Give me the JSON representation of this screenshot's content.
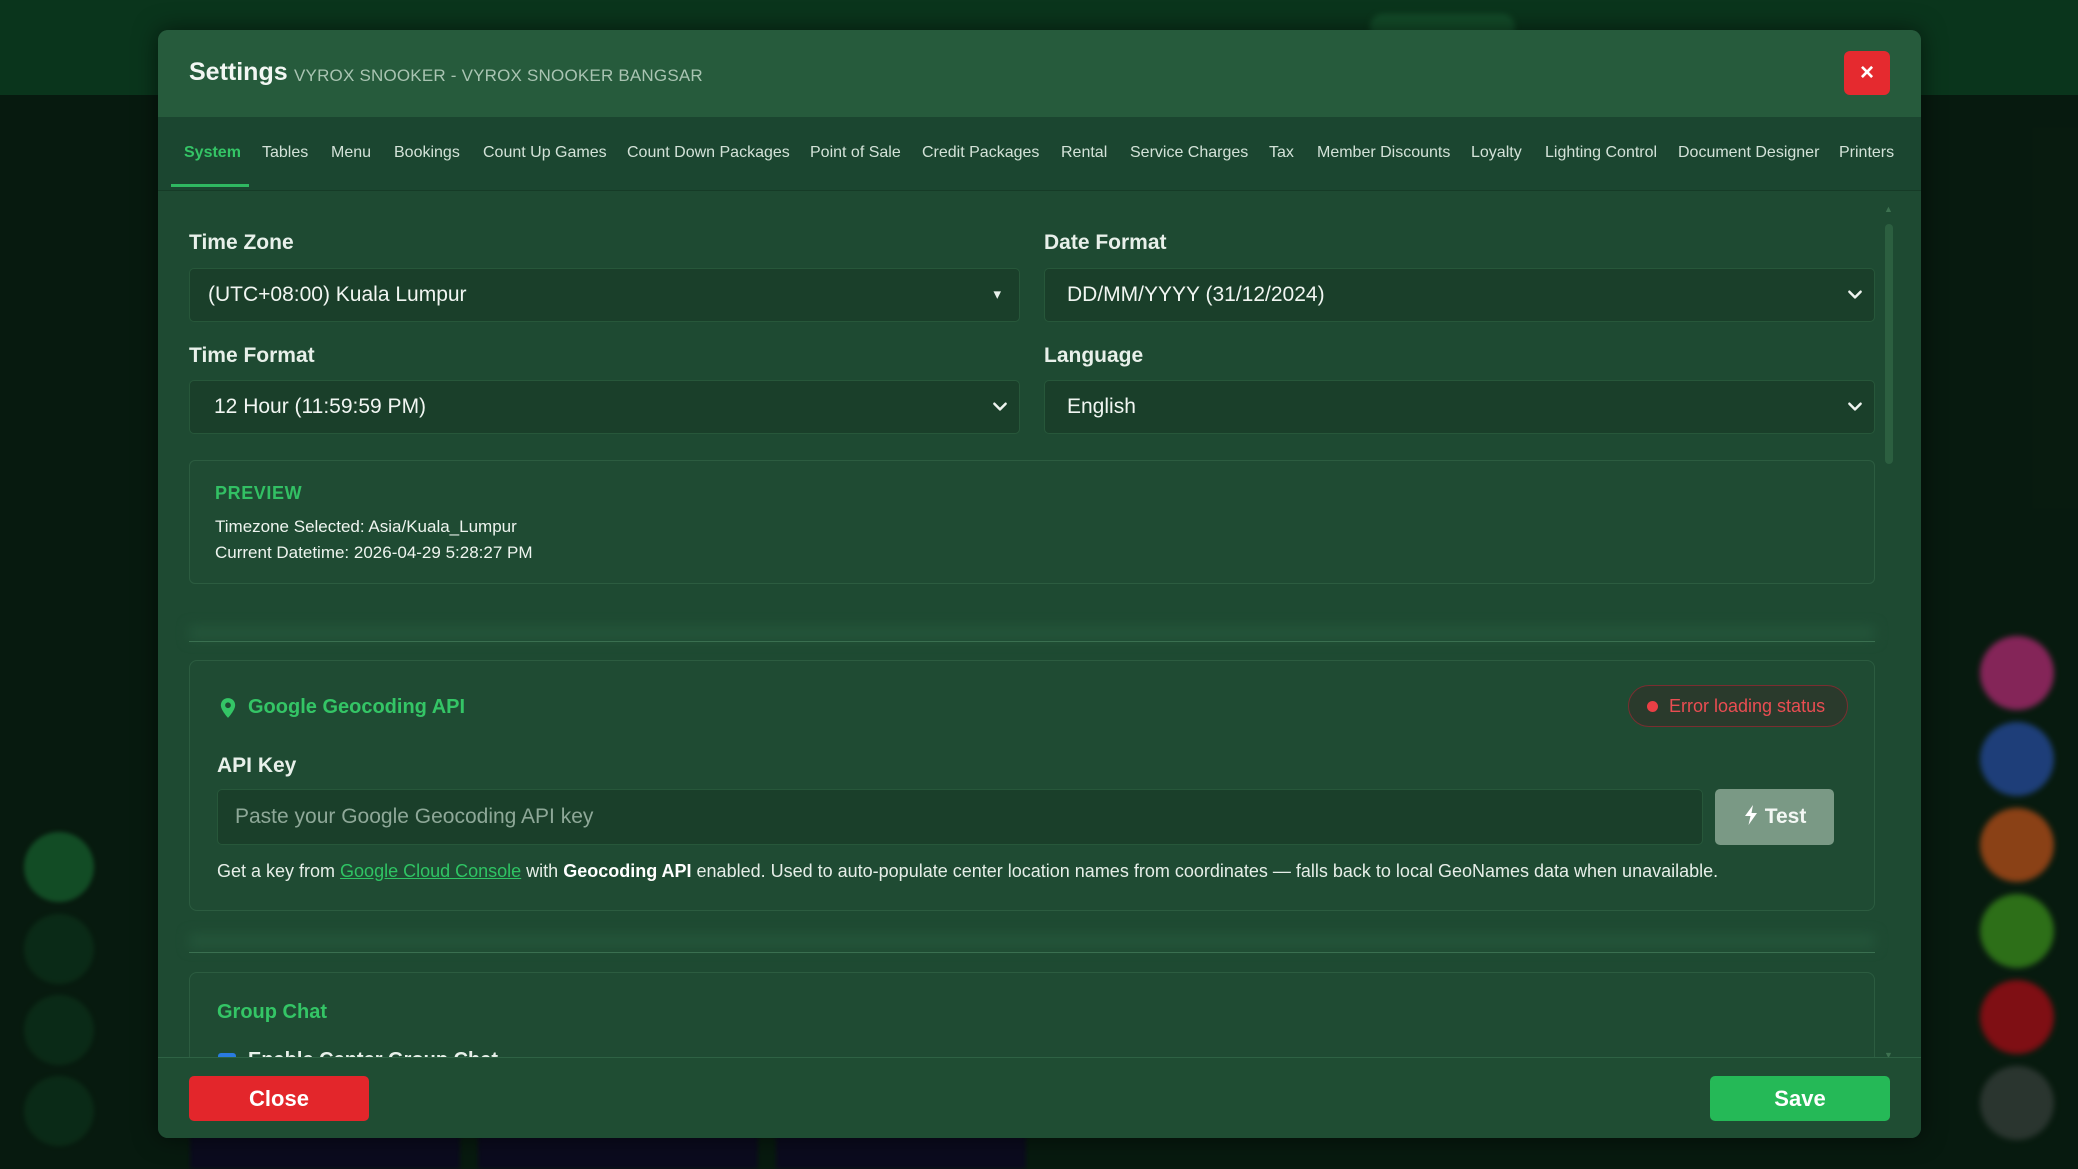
{
  "modal": {
    "title": "Settings",
    "subtitle": "VYROX SNOOKER - VYROX SNOOKER BANGSAR",
    "close_icon": "×"
  },
  "tabs": [
    {
      "label": "System",
      "active": true
    },
    {
      "label": "Tables"
    },
    {
      "label": "Menu"
    },
    {
      "label": "Bookings"
    },
    {
      "label": "Count Up Games"
    },
    {
      "label": "Count Down Packages"
    },
    {
      "label": "Point of Sale"
    },
    {
      "label": "Credit Packages"
    },
    {
      "label": "Rental"
    },
    {
      "label": "Service Charges"
    },
    {
      "label": "Tax"
    },
    {
      "label": "Member Discounts"
    },
    {
      "label": "Loyalty"
    },
    {
      "label": "Lighting Control"
    },
    {
      "label": "Document Designer"
    },
    {
      "label": "Printers"
    }
  ],
  "system": {
    "time_zone": {
      "label": "Time Zone",
      "value": "(UTC+08:00) Kuala Lumpur"
    },
    "date_format": {
      "label": "Date Format",
      "value": "DD/MM/YYYY (31/12/2024)"
    },
    "time_format": {
      "label": "Time Format",
      "value": "12 Hour (11:59:59 PM)"
    },
    "language": {
      "label": "Language",
      "value": "English"
    },
    "preview": {
      "title": "PREVIEW",
      "timezone_line": "Timezone Selected: Asia/Kuala_Lumpur",
      "datetime_line": "Current Datetime: 2026-04-29 5:28:27 PM"
    }
  },
  "geocoding": {
    "title": "Google Geocoding API",
    "status": "Error loading status",
    "api_key_label": "API Key",
    "api_key_value": "",
    "api_key_placeholder": "Paste your Google Geocoding API key",
    "test_label": "Test",
    "help_prefix": "Get a key from ",
    "help_link": "Google Cloud Console",
    "help_middle": " with ",
    "help_bold": "Geocoding API",
    "help_suffix": " enabled. Used to auto-populate center location names from coordinates — falls back to local GeoNames data when unavailable."
  },
  "group_chat": {
    "title": "Group Chat",
    "enable_label": "Enable Center Group Chat",
    "enabled": true
  },
  "footer": {
    "close_label": "Close",
    "save_label": "Save"
  },
  "colors": {
    "accent": "#34c566",
    "modal_bg": "#1e4a32",
    "danger": "#e3262b",
    "success": "#25b957",
    "error_text": "#ea4d52"
  }
}
